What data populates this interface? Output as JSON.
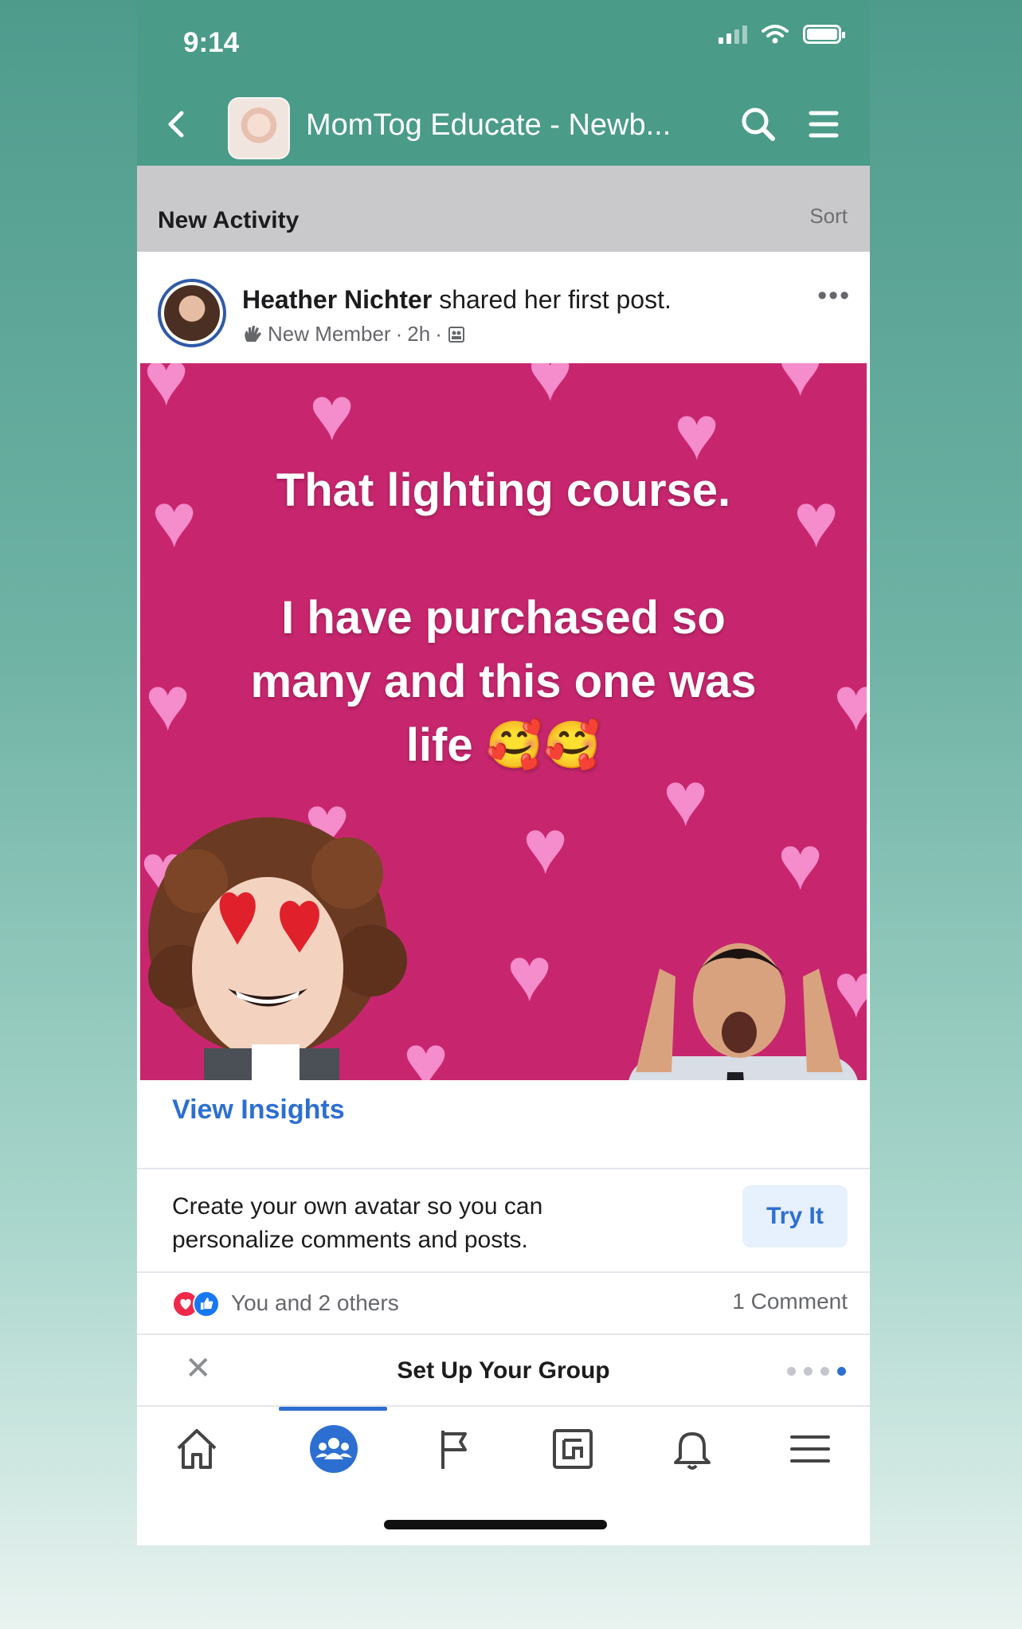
{
  "status_bar": {
    "time": "9:14"
  },
  "header": {
    "group_title": "MomTog Educate - Newb...",
    "back_icon": "chevron-left-icon",
    "search_icon": "search-icon",
    "menu_icon": "hamburger-menu-icon"
  },
  "activity_bar": {
    "title": "New Activity",
    "sort_label": "Sort"
  },
  "post": {
    "author": "Heather Nichter",
    "action": " shared her first post.",
    "badge": "New Member",
    "time": "2h",
    "separator": "·",
    "image_text": "That lighting course.\n\nI have purchased so\nmany and this one was\nlife 🥰🥰"
  },
  "insights": {
    "label": "View Insights"
  },
  "avatar_prompt": {
    "text": "Create your own avatar so you can personalize comments and posts.",
    "button": "Try It"
  },
  "reactions": {
    "text": "You and 2 others",
    "comments": "1 Comment"
  },
  "setup": {
    "title": "Set Up Your Group",
    "close_symbol": "✕"
  },
  "colors": {
    "header_bg": "#4a9b88",
    "post_bg": "#c7266e",
    "accent": "#2d6fd1"
  },
  "tabbar": {
    "tabs": [
      "home-icon",
      "groups-icon",
      "flag-icon",
      "news-icon",
      "bell-icon",
      "menu-icon"
    ],
    "active": "groups-icon"
  }
}
